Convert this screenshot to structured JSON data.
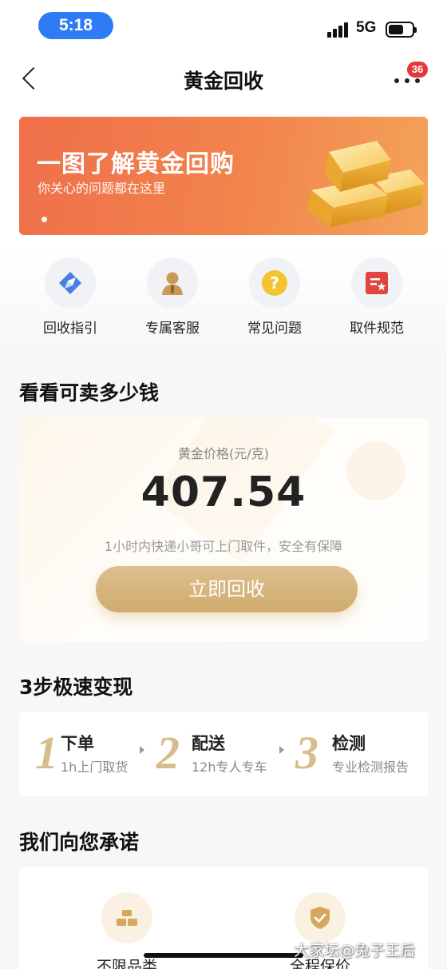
{
  "status_bar": {
    "time": "5:18",
    "network": "5G"
  },
  "nav": {
    "title": "黄金回收",
    "badge_count": "36"
  },
  "banner": {
    "title": "一图了解黄金回购",
    "subtitle": "你关心的问题都在这里",
    "colors": {
      "start": "#ef6f4a",
      "end": "#f3a35b"
    }
  },
  "quick_links": [
    {
      "label": "回收指引",
      "icon": "compass-icon"
    },
    {
      "label": "专属客服",
      "icon": "service-agent-icon"
    },
    {
      "label": "常见问题",
      "icon": "question-icon"
    },
    {
      "label": "取件规范",
      "icon": "document-star-icon"
    }
  ],
  "price_section": {
    "title": "看看可卖多少钱",
    "price_label": "黄金价格(元/克)",
    "price": "407.54",
    "description": "1小时内快递小哥可上门取件，安全有保障",
    "button_label": "立即回收",
    "accent_color": "#cfab6d"
  },
  "steps_section": {
    "title": "3步极速变现",
    "steps": [
      {
        "num": "1",
        "title": "下单",
        "sub": "1h上门取货"
      },
      {
        "num": "2",
        "title": "配送",
        "sub": "12h专人专车"
      },
      {
        "num": "3",
        "title": "检测",
        "sub": "专业检测报告"
      }
    ]
  },
  "promise_section": {
    "title": "我们向您承诺",
    "items": [
      {
        "label": "不限品类",
        "icon": "gold-bars-icon"
      },
      {
        "label": "全程保价",
        "icon": "shield-check-icon"
      }
    ]
  },
  "watermark": "大家坛@兔子王后"
}
